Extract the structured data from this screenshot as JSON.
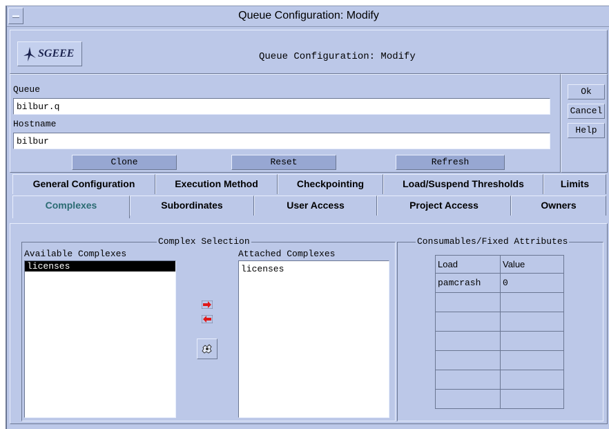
{
  "window": {
    "title": "Queue Configuration: Modify"
  },
  "header": {
    "logo_text": "SGEEE",
    "title": "Queue Configuration: Modify"
  },
  "form": {
    "queue_label": "Queue",
    "queue_value": "bilbur.q",
    "hostname_label": "Hostname",
    "hostname_value": "bilbur",
    "clone_label": "Clone",
    "reset_label": "Reset",
    "refresh_label": "Refresh"
  },
  "side_buttons": {
    "ok": "Ok",
    "cancel": "Cancel",
    "help": "Help"
  },
  "tabs_row1": [
    {
      "label": "General Configuration"
    },
    {
      "label": "Execution Method"
    },
    {
      "label": "Checkpointing"
    },
    {
      "label": "Load/Suspend Thresholds"
    },
    {
      "label": "Limits"
    }
  ],
  "tabs_row2": [
    {
      "label": "Complexes",
      "active": true
    },
    {
      "label": "Subordinates"
    },
    {
      "label": "User Access"
    },
    {
      "label": "Project Access"
    },
    {
      "label": "Owners"
    }
  ],
  "complex_selection": {
    "title": "Complex Selection",
    "available_label": "Available Complexes",
    "available_items": [
      "licenses"
    ],
    "attached_label": "Attached Complexes",
    "attached_items": [
      "licenses"
    ]
  },
  "consumables": {
    "title": "Consumables/Fixed Attributes",
    "columns": [
      "Load",
      "Value"
    ],
    "rows": [
      [
        "pamcrash",
        "0"
      ],
      [
        "",
        ""
      ],
      [
        "",
        ""
      ],
      [
        "",
        ""
      ],
      [
        "",
        ""
      ],
      [
        "",
        ""
      ],
      [
        "",
        ""
      ]
    ]
  },
  "colors": {
    "background": "#bcc8e8",
    "button": "#97a7d2",
    "active_tab_text": "#2a6b72",
    "arrow_red": "#e01818"
  },
  "icons": [
    "window-menu-icon",
    "sgeee-logo-icon",
    "arrow-right-icon",
    "arrow-left-icon",
    "complex-transfer-icon"
  ]
}
